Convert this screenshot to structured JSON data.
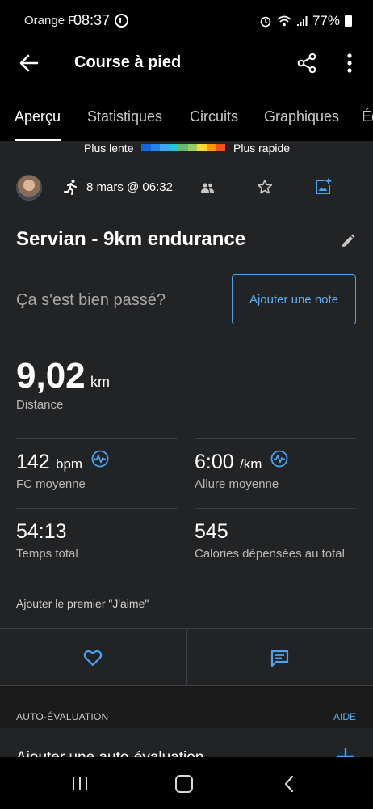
{
  "status_bar": {
    "carrier": "Orange F",
    "time": "08:37",
    "battery": "77%"
  },
  "app_bar": {
    "title": "Course à pied",
    "icons": [
      "back-arrow-icon",
      "share-icon",
      "more-vert-icon"
    ]
  },
  "tabs": [
    {
      "label": "Aperçu",
      "active": true
    },
    {
      "label": "Statistiques"
    },
    {
      "label": "Circuits"
    },
    {
      "label": "Graphiques"
    },
    {
      "label": "Éq"
    }
  ],
  "pace_legend": {
    "slow": "Plus lente",
    "fast": "Plus rapide",
    "colors": [
      "#1565d8",
      "#1e88e5",
      "#42a5f5",
      "#26c6da",
      "#66bb6a",
      "#9ccc65",
      "#fdd835",
      "#ff9800",
      "#f4511e"
    ]
  },
  "activity": {
    "date": "8 mars @ 06:32",
    "title": "Servian - 9km endurance",
    "question": "Ça s'est bien passé?",
    "add_note": "Ajouter une note"
  },
  "stats": {
    "distance": {
      "value": "9,02",
      "unit": "km",
      "label": "Distance"
    },
    "heart_rate": {
      "value": "142",
      "unit": "bpm",
      "label": "FC moyenne"
    },
    "pace": {
      "value": "6:00",
      "unit": "/km",
      "label": "Allure moyenne"
    },
    "time": {
      "value": "54:13",
      "label": "Temps total"
    },
    "calories": {
      "value": "545",
      "label": "Calories dépensées au total"
    }
  },
  "social": {
    "likes_text": "Ajouter le premier \"J'aime\""
  },
  "self_eval": {
    "section_label": "AUTO-ÉVALUATION",
    "help": "AIDE",
    "add_label": "Ajouter une auto-évaluation"
  },
  "accent_color": "#4aa3f5"
}
